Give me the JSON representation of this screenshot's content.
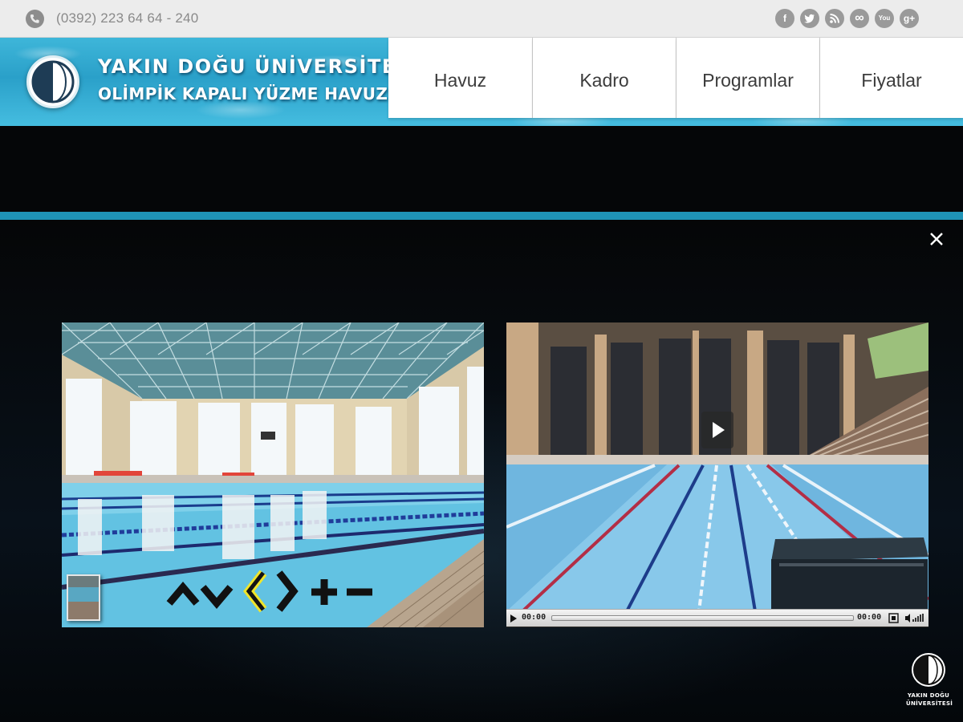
{
  "topbar": {
    "phone_icon": "phone-icon",
    "phone": "(0392) 223 64 64 - 240",
    "social": [
      {
        "name": "facebook-icon",
        "glyph": "f"
      },
      {
        "name": "twitter-icon",
        "glyph": ""
      },
      {
        "name": "rss-icon",
        "glyph": ""
      },
      {
        "name": "flickr-icon",
        "glyph": "∞"
      },
      {
        "name": "youtube-icon",
        "glyph": "You"
      },
      {
        "name": "google-plus-icon",
        "glyph": "g+"
      }
    ]
  },
  "header": {
    "title_line1": "YAKIN DOĞU ÜNİVERSİTESİ",
    "title_line2": "OLİMPİK KAPALI YÜZME HAVUZU",
    "logo_icon": "university-logo-icon"
  },
  "nav": {
    "items": [
      {
        "label": "Havuz"
      },
      {
        "label": "Kadro"
      },
      {
        "label": "Programlar"
      },
      {
        "label": "Fiyatlar"
      }
    ]
  },
  "lightbox": {
    "close_icon": "close-icon",
    "photo_controls": [
      "up-arrow-icon",
      "down-arrow-icon",
      "left-arrow-icon",
      "right-arrow-icon",
      "plus-icon",
      "minus-icon"
    ]
  },
  "video": {
    "current_time": "00:00",
    "duration": "00:00",
    "play_icon": "play-icon"
  },
  "footer_brand": {
    "line1": "YAKIN DOĞU",
    "line2": "ÜNİVERSİTESİ"
  },
  "colors": {
    "accent_band": "#1f93b6",
    "header_water": "#2aa0c9",
    "nav_bg": "#ffffff",
    "topbar_bg": "#ececec",
    "active_arrow": "#f0e52b"
  }
}
